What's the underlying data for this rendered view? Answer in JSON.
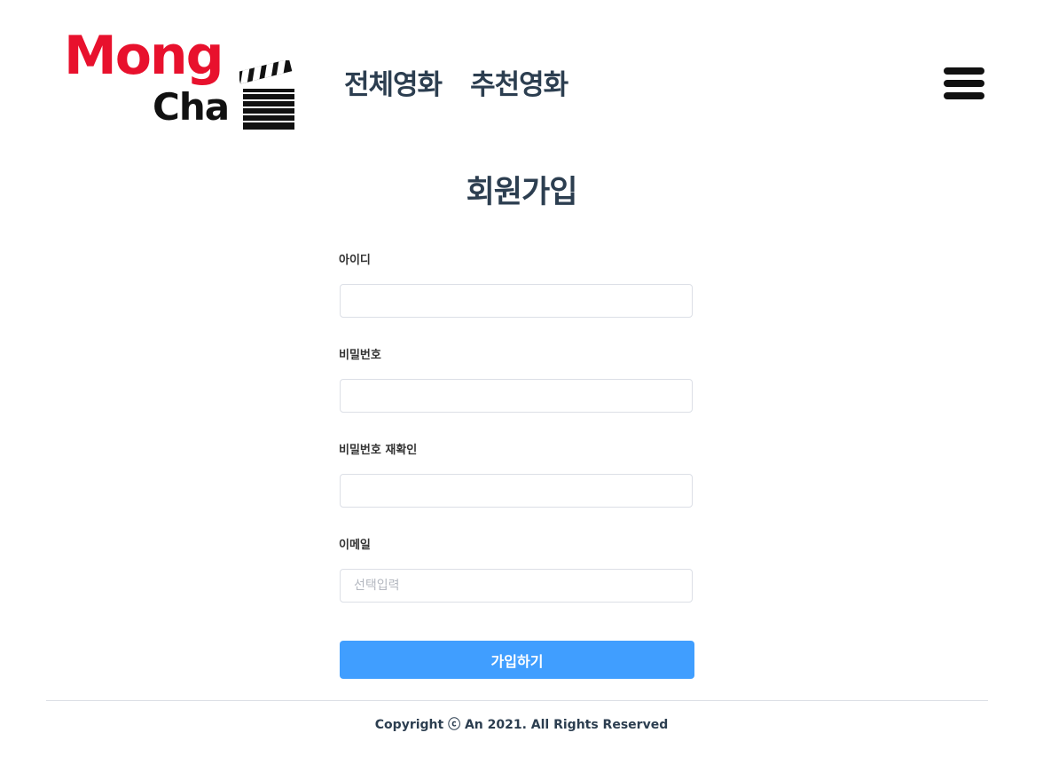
{
  "header": {
    "logo": {
      "line1": "Mong",
      "line2": "Cha",
      "icon": "clapperboard-icon",
      "brand_color": "#e8112d"
    },
    "nav": [
      {
        "label": "전체영화"
      },
      {
        "label": "추천영화"
      }
    ],
    "menu_icon": "hamburger-menu-icon"
  },
  "signup": {
    "title": "회원가입",
    "fields": {
      "id": {
        "label": "아이디",
        "value": "",
        "placeholder": ""
      },
      "password": {
        "label": "비밀번호",
        "value": "",
        "placeholder": ""
      },
      "password_confirm": {
        "label": "비밀번호 재확인",
        "value": "",
        "placeholder": ""
      },
      "email": {
        "label": "이메일",
        "value": "",
        "placeholder": "선택입력"
      }
    },
    "submit_label": "가입하기",
    "accent_color": "#409eff"
  },
  "footer": {
    "copyright": "Copyright ⓒ An 2021. All Rights Reserved"
  }
}
